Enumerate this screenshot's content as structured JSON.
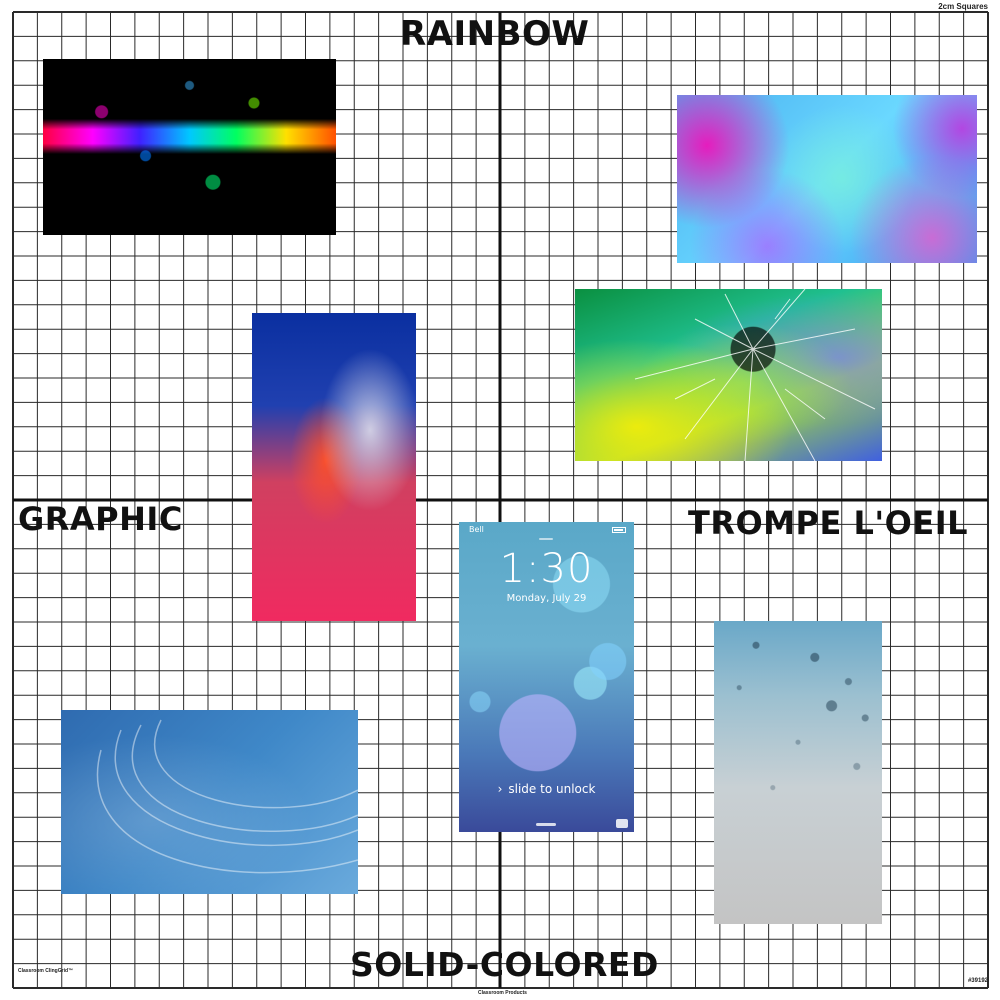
{
  "grid": {
    "scale_note": "2cm Squares",
    "brand": "Classroom ClingGrid™",
    "product_code": "#39192",
    "maker": "Classroom Products"
  },
  "axes": {
    "top": "RAINBOW",
    "bottom": "SOLID-COLORED",
    "left": "GRAPHIC",
    "right": "TROMPE L'OEIL"
  },
  "phone": {
    "carrier": "Bell",
    "time": "1:30",
    "date": "Monday, July 29",
    "unlock": "slide to unlock"
  },
  "colors": {
    "grid_line": "#2a2a2a",
    "axis_line": "#111111",
    "background": "#ffffff"
  }
}
